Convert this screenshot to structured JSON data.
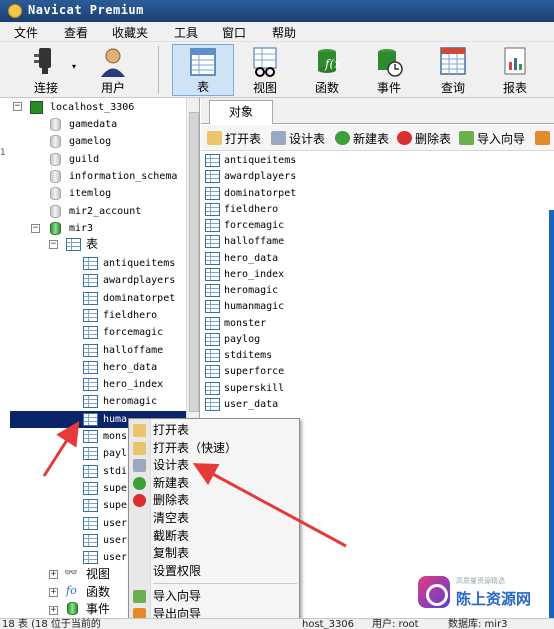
{
  "window": {
    "title": "Navicat Premium"
  },
  "menubar": [
    "文件",
    "查看",
    "收藏夹",
    "工具",
    "窗口",
    "帮助"
  ],
  "toolbar": [
    {
      "label": "连接",
      "icon": "plug-icon"
    },
    {
      "label": "用户",
      "icon": "user-icon"
    },
    {
      "label": "表",
      "icon": "table-icon",
      "active": true
    },
    {
      "label": "视图",
      "icon": "view-icon"
    },
    {
      "label": "函数",
      "icon": "function-icon"
    },
    {
      "label": "事件",
      "icon": "event-icon"
    },
    {
      "label": "查询",
      "icon": "query-icon"
    },
    {
      "label": "报表",
      "icon": "report-icon"
    }
  ],
  "tree": {
    "connection": "localhost_3306",
    "databases": [
      "gamedata",
      "gamelog",
      "guild",
      "information_schema",
      "itemlog",
      "mir2_account",
      "mir3"
    ],
    "tables_label": "表",
    "tables": [
      "antiqueitems",
      "awardplayers",
      "dominatorpet",
      "fieldhero",
      "forcemagic",
      "halloffame",
      "hero_data",
      "hero_index",
      "heromagic",
      "humanmagic",
      "monster",
      "paylog",
      "stditems",
      "superforce",
      "superskill",
      "user_data",
      "user_",
      "user_"
    ],
    "truncated_tables": [
      "huma",
      "mons",
      "payl",
      "stdi",
      "supe",
      "supe",
      "user",
      "user",
      "user"
    ],
    "other_nodes": [
      "视图",
      "函数",
      "事件"
    ]
  },
  "tabs": {
    "objects": "对象"
  },
  "object_toolbar": [
    "打开表",
    "设计表",
    "新建表",
    "删除表",
    "导入向导"
  ],
  "object_list": [
    "antiqueitems",
    "awardplayers",
    "dominatorpet",
    "fieldhero",
    "forcemagic",
    "halloffame",
    "hero_data",
    "hero_index",
    "heromagic",
    "humanmagic",
    "monster",
    "paylog",
    "stditems",
    "superforce",
    "superskill",
    "user_data"
  ],
  "context_menu": {
    "items": [
      "打开表",
      "打开表（快速）",
      "设计表",
      "新建表",
      "删除表",
      "清空表",
      "截断表",
      "复制表",
      "设置权限",
      "导入向导",
      "导出向导"
    ]
  },
  "status": {
    "left": "18 表 (18 位于当前的",
    "middle": "host_3306",
    "user": "用户: root",
    "database": "数据库: mir3"
  },
  "watermark": {
    "small": "高质量资源精选",
    "big": "陈上资源网"
  },
  "side_digit": "1",
  "colors": {
    "selection": "#0a246a",
    "annotation_arrow": "#e5393a",
    "title_bar": "#2b5c97"
  }
}
